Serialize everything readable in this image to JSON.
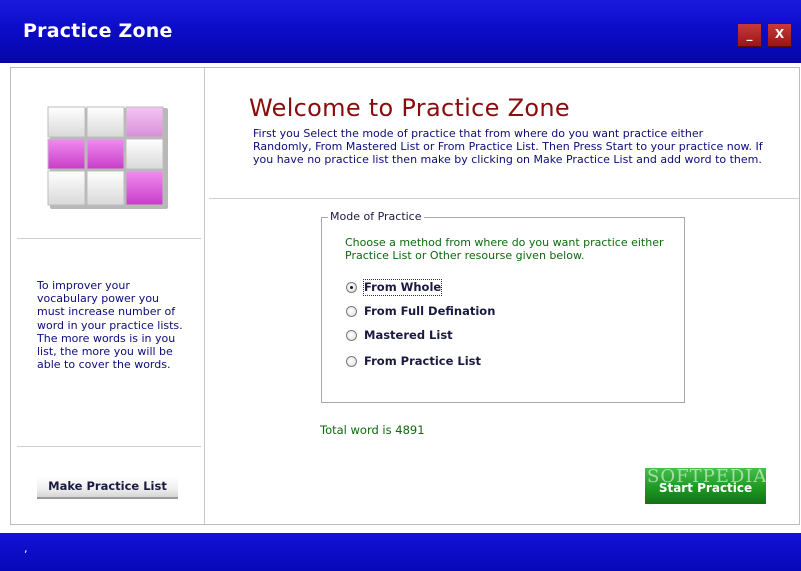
{
  "window": {
    "title": "Practice Zone",
    "minimize_label": "_",
    "close_label": "X",
    "colors": {
      "titlebar": "#0c0cc8",
      "accent_red": "#8b0c0c",
      "green_text": "#0c6a0c",
      "navy_text": "#0c0c7a"
    }
  },
  "sidebar": {
    "logo_icon": "grid-logo-icon",
    "info_text": "To improver your vocabulary power you must increase number of word in your practice lists. The more words is in you list, the more you will be able to cover the words.",
    "make_list_label": "Make Practice List"
  },
  "main": {
    "welcome_title": "Welcome to Practice Zone",
    "intro_text": "First you Select the mode of practice that from where do you want practice either Randomly,  From Mastered List or From Practice List. Then Press Start to your practice now. If you have no practice list then make by clicking on Make Practice List and add word to them.",
    "mode_group": {
      "legend": "Mode of Practice",
      "description": "Choose a method from where do you want practice either Practice List or Other resourse given below.",
      "options": [
        {
          "label": "From Whole",
          "checked": true
        },
        {
          "label": "From Full Defination",
          "checked": false
        },
        {
          "label": "Mastered List",
          "checked": false
        },
        {
          "label": "From Practice List",
          "checked": false
        }
      ]
    },
    "total_words": "Total word is 4891",
    "start_label": "Start Practice",
    "watermark": "SOFTPEDIA"
  },
  "statusbar": {
    "text": ","
  }
}
